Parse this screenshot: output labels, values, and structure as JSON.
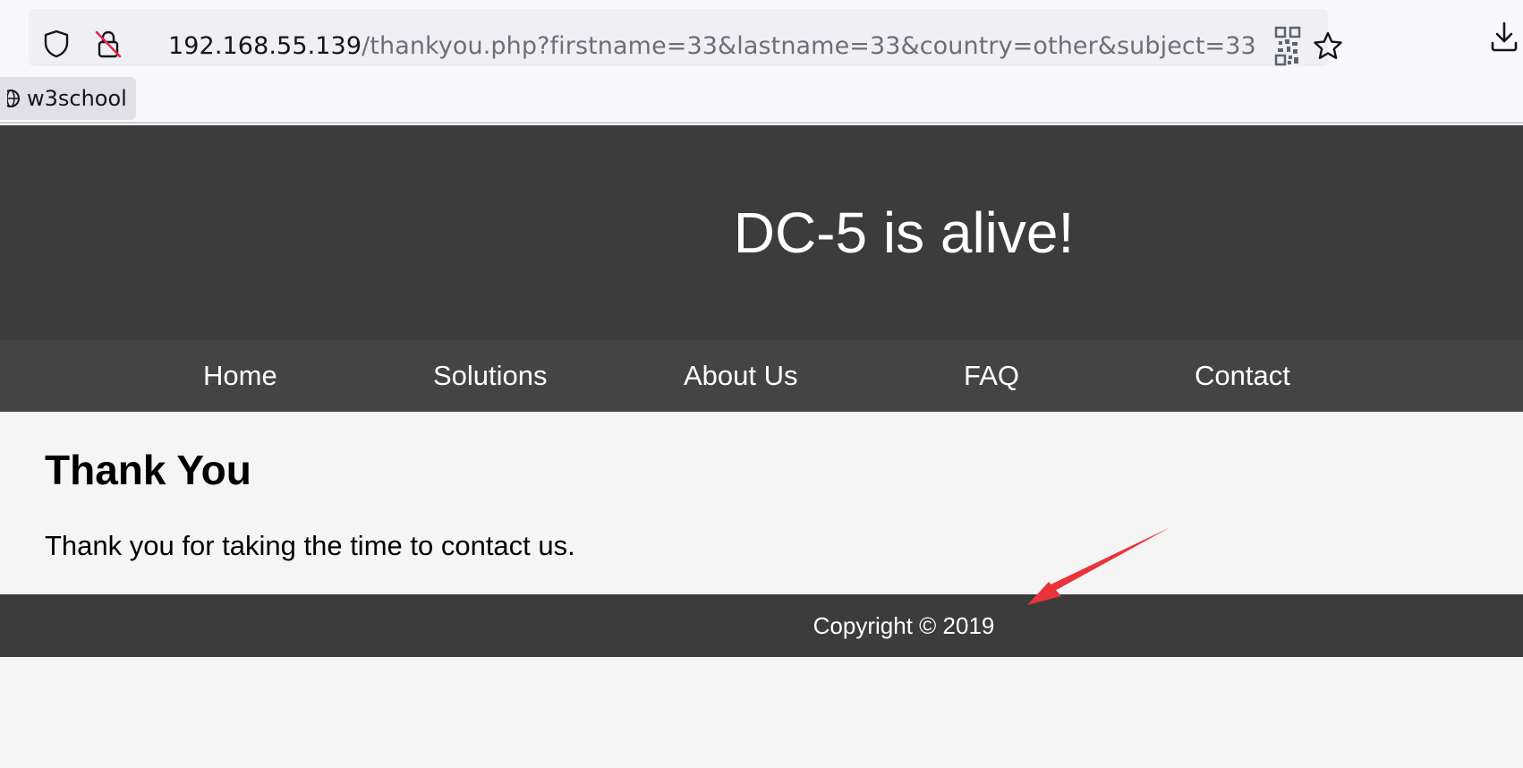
{
  "browser": {
    "url_host": "192.168.55.139",
    "url_path": "/thankyou.php?firstname=33&lastname=33&country=other&subject=33",
    "icons": [
      "shield-icon",
      "insecure-lock-icon",
      "qr-code-icon",
      "bookmark-star-icon",
      "download-icon"
    ],
    "bookmarks": [
      {
        "label": "w3school",
        "icon": "globe-icon"
      }
    ]
  },
  "site": {
    "title": "DC-5 is alive!",
    "nav": [
      "Home",
      "Solutions",
      "About Us",
      "FAQ",
      "Contact"
    ],
    "heading": "Thank You",
    "message": "Thank you for taking the time to contact us.",
    "footer": "Copyright © 2019"
  },
  "annotation": {
    "type": "arrow",
    "color": "#e8343a"
  },
  "colors": {
    "header_bg": "#3c3c3c",
    "nav_bg": "#444444",
    "page_bg": "#f5f5f5"
  }
}
